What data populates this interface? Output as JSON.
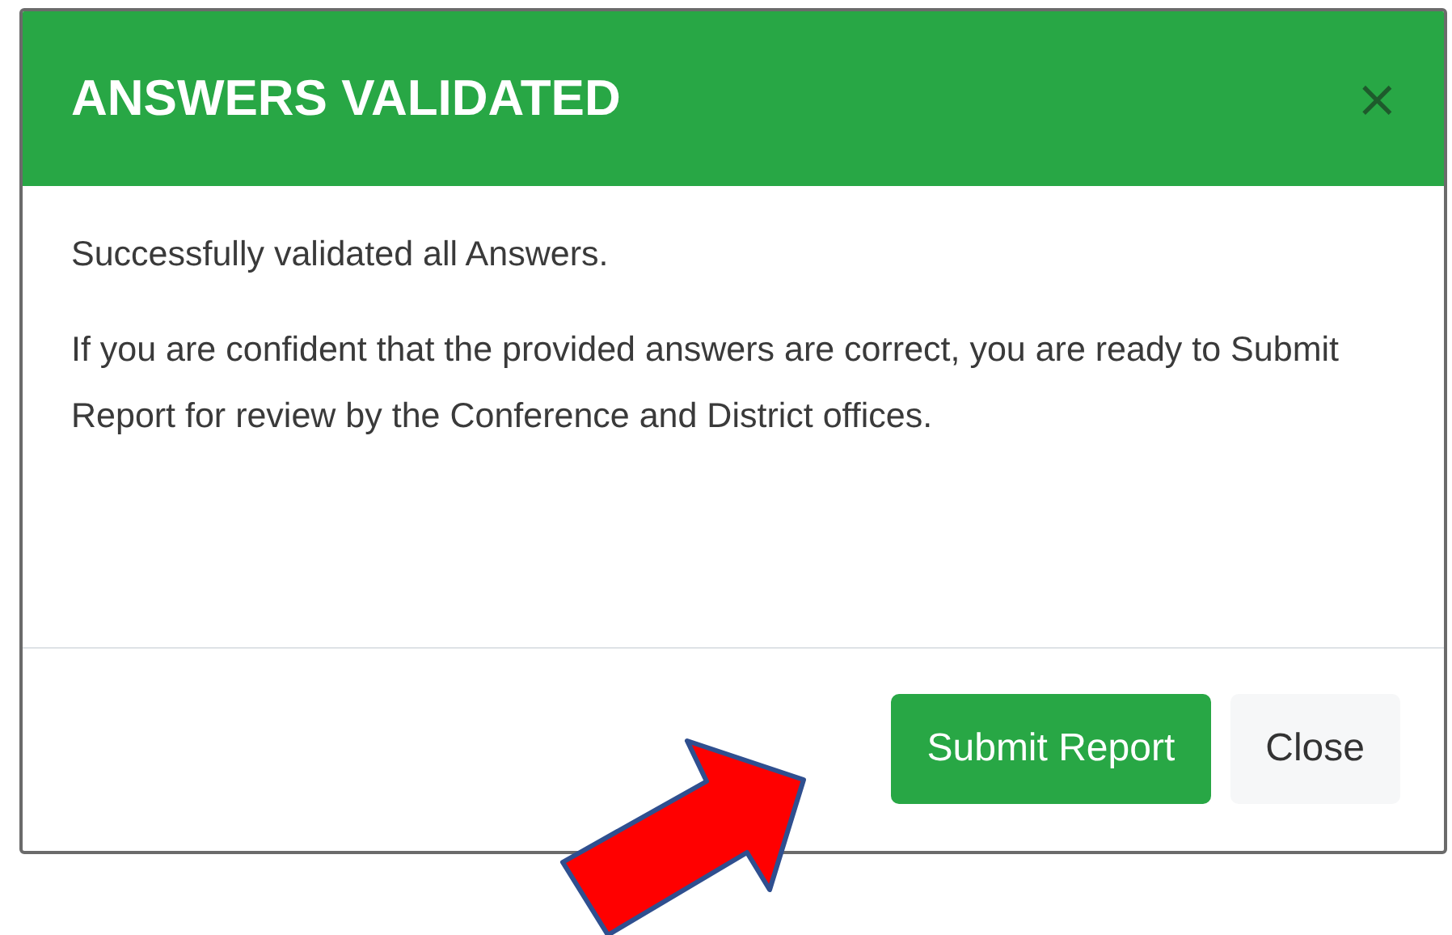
{
  "dialog": {
    "title": "ANSWERS VALIDATED",
    "close_icon": "×",
    "paragraphs": [
      "Successfully validated all Answers.",
      "If you are confident that the provided answers are correct, you are ready to Submit Report for review by the Conference and District offices."
    ],
    "buttons": [
      {
        "label": "Submit Report",
        "kind": "primary"
      },
      {
        "label": "Close",
        "kind": "secondary"
      }
    ]
  }
}
